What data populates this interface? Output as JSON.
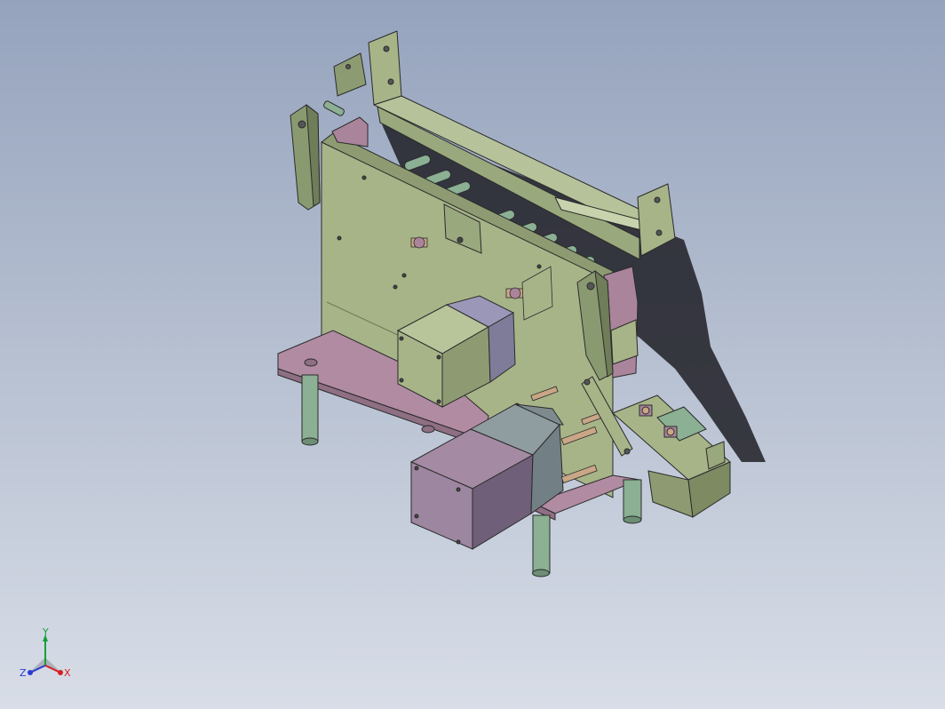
{
  "viewport": {
    "background_top": "#95a3bd",
    "background_bottom": "#d8dde7"
  },
  "model": {
    "colors": {
      "plate_green": "#a7b488",
      "plate_green_dark": "#7d8a62",
      "base_mauve": "#a9849a",
      "motor_mauve": "#9b7f9b",
      "motor_gray": "#7e8b8e",
      "legs": "#8bb093",
      "rods": "#c9a686",
      "shadow": "#1f1f26",
      "edge": "#2b2b2b"
    }
  },
  "triad": {
    "x_label": "X",
    "y_label": "Y",
    "z_label": "Z",
    "x_color": "#d52020",
    "y_color": "#15a03a",
    "z_color": "#2a3bd0"
  }
}
